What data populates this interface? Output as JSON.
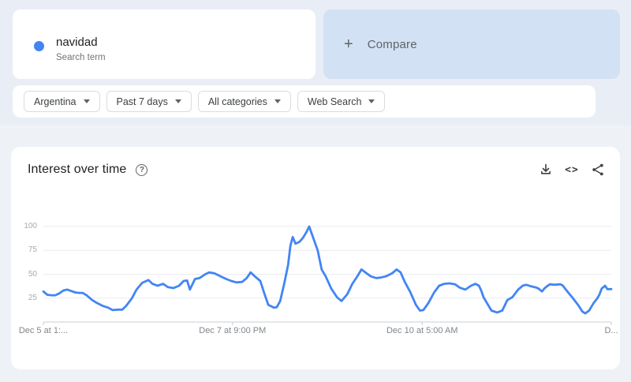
{
  "search_card": {
    "term": "navidad",
    "type_label": "Search term",
    "dot_color": "#4285f4"
  },
  "compare_card": {
    "plus_glyph": "+",
    "label": "Compare"
  },
  "filter_bar": {
    "region": "Argentina",
    "time_range": "Past 7 days",
    "category": "All categories",
    "search_type": "Web Search"
  },
  "chart_card": {
    "title": "Interest over time",
    "help_glyph": "?",
    "embed_glyph": "<>",
    "icons": [
      "download-icon",
      "embed-icon",
      "share-icon"
    ]
  },
  "chart_data": {
    "type": "line",
    "title": "Interest over time",
    "xlabel": "",
    "ylabel": "",
    "ylim": [
      0,
      100
    ],
    "yticks": [
      25,
      50,
      75,
      100
    ],
    "grid": true,
    "legend": false,
    "xticks": [
      {
        "t": 0.0,
        "label": "Dec 5 at 1:..."
      },
      {
        "t": 0.333,
        "label": "Dec 7 at 9:00 PM"
      },
      {
        "t": 0.667,
        "label": "Dec 10 at 5:00 AM"
      },
      {
        "t": 1.0,
        "label": "D..."
      }
    ],
    "series": [
      {
        "name": "navidad",
        "color": "#4285f4",
        "points": [
          [
            0,
            32
          ],
          [
            0.007,
            28.5
          ],
          [
            0.014,
            28
          ],
          [
            0.021,
            28
          ],
          [
            0.028,
            30
          ],
          [
            0.035,
            33
          ],
          [
            0.042,
            34
          ],
          [
            0.049,
            32.5
          ],
          [
            0.056,
            31
          ],
          [
            0.063,
            30.5
          ],
          [
            0.069,
            30.5
          ],
          [
            0.076,
            28
          ],
          [
            0.086,
            23
          ],
          [
            0.094,
            20
          ],
          [
            0.104,
            17
          ],
          [
            0.114,
            15
          ],
          [
            0.122,
            12.5
          ],
          [
            0.132,
            13
          ],
          [
            0.139,
            13
          ],
          [
            0.146,
            17
          ],
          [
            0.156,
            25
          ],
          [
            0.164,
            34
          ],
          [
            0.174,
            41
          ],
          [
            0.185,
            44
          ],
          [
            0.192,
            40
          ],
          [
            0.201,
            38
          ],
          [
            0.211,
            40
          ],
          [
            0.219,
            36.5
          ],
          [
            0.229,
            35.5
          ],
          [
            0.239,
            38
          ],
          [
            0.247,
            43
          ],
          [
            0.253,
            43.5
          ],
          [
            0.258,
            34
          ],
          [
            0.267,
            45
          ],
          [
            0.275,
            46
          ],
          [
            0.285,
            50
          ],
          [
            0.292,
            52
          ],
          [
            0.301,
            51
          ],
          [
            0.313,
            47.5
          ],
          [
            0.322,
            45
          ],
          [
            0.331,
            43
          ],
          [
            0.34,
            41.5
          ],
          [
            0.35,
            42
          ],
          [
            0.358,
            46
          ],
          [
            0.365,
            52
          ],
          [
            0.372,
            48
          ],
          [
            0.382,
            43
          ],
          [
            0.389,
            30
          ],
          [
            0.396,
            18
          ],
          [
            0.406,
            15
          ],
          [
            0.411,
            15.5
          ],
          [
            0.417,
            22
          ],
          [
            0.424,
            40
          ],
          [
            0.431,
            60
          ],
          [
            0.435,
            80
          ],
          [
            0.439,
            89
          ],
          [
            0.444,
            82
          ],
          [
            0.451,
            84
          ],
          [
            0.457,
            88
          ],
          [
            0.463,
            94
          ],
          [
            0.468,
            100
          ],
          [
            0.474,
            90
          ],
          [
            0.483,
            75
          ],
          [
            0.49,
            55
          ],
          [
            0.497,
            48
          ],
          [
            0.507,
            35
          ],
          [
            0.517,
            26
          ],
          [
            0.521,
            24
          ],
          [
            0.525,
            22
          ],
          [
            0.535,
            29
          ],
          [
            0.544,
            40
          ],
          [
            0.553,
            48
          ],
          [
            0.56,
            55
          ],
          [
            0.567,
            52
          ],
          [
            0.576,
            48
          ],
          [
            0.586,
            46
          ],
          [
            0.594,
            46.5
          ],
          [
            0.604,
            48
          ],
          [
            0.614,
            51
          ],
          [
            0.622,
            55
          ],
          [
            0.629,
            52
          ],
          [
            0.636,
            42.5
          ],
          [
            0.646,
            31.5
          ],
          [
            0.656,
            18
          ],
          [
            0.663,
            12
          ],
          [
            0.669,
            12.5
          ],
          [
            0.678,
            20
          ],
          [
            0.688,
            31
          ],
          [
            0.697,
            38
          ],
          [
            0.706,
            40
          ],
          [
            0.715,
            40.5
          ],
          [
            0.725,
            39.5
          ],
          [
            0.733,
            36
          ],
          [
            0.743,
            34
          ],
          [
            0.753,
            38
          ],
          [
            0.761,
            40
          ],
          [
            0.767,
            38
          ],
          [
            0.771,
            33
          ],
          [
            0.775,
            26
          ],
          [
            0.781,
            20
          ],
          [
            0.789,
            12
          ],
          [
            0.799,
            10
          ],
          [
            0.808,
            12
          ],
          [
            0.817,
            23
          ],
          [
            0.826,
            26
          ],
          [
            0.836,
            34
          ],
          [
            0.844,
            38
          ],
          [
            0.85,
            39
          ],
          [
            0.858,
            37.5
          ],
          [
            0.868,
            36
          ],
          [
            0.872,
            35
          ],
          [
            0.878,
            32
          ],
          [
            0.882,
            35
          ],
          [
            0.886,
            37
          ],
          [
            0.892,
            39.5
          ],
          [
            0.9,
            39
          ],
          [
            0.91,
            39.5
          ],
          [
            0.914,
            38.5
          ],
          [
            0.924,
            31
          ],
          [
            0.933,
            24.5
          ],
          [
            0.942,
            17.5
          ],
          [
            0.949,
            11
          ],
          [
            0.954,
            9
          ],
          [
            0.961,
            12
          ],
          [
            0.969,
            20
          ],
          [
            0.975,
            24.5
          ],
          [
            0.979,
            28.5
          ],
          [
            0.983,
            35
          ],
          [
            0.989,
            38
          ],
          [
            0.993,
            34.5
          ],
          [
            1,
            34.5
          ]
        ]
      }
    ]
  },
  "colors": {
    "hero_bg": "#e9edf6",
    "page_bg": "#eef1f5",
    "compare_card_bg": "#d2e1f4",
    "accent_blue": "#4285f4",
    "grid_line": "#e9ebef",
    "axis_line": "#c9ccd1",
    "muted_text": "#5f6368"
  }
}
